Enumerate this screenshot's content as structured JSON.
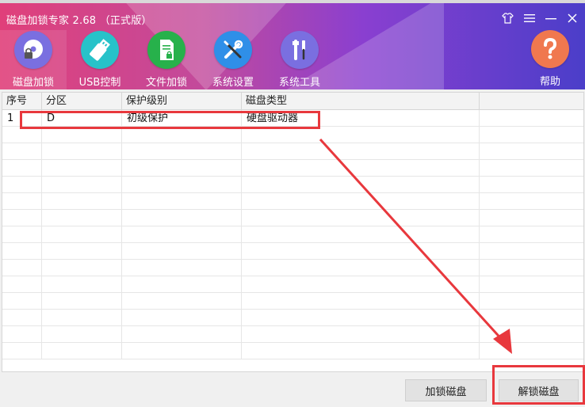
{
  "window": {
    "title": "磁盘加锁专家 2.68 （正式版）"
  },
  "nav": {
    "items": [
      {
        "label": "磁盘加锁",
        "icon": "disk-lock-icon",
        "color": "#7a6fe0"
      },
      {
        "label": "USB控制",
        "icon": "usb-icon",
        "color": "#27c2c9"
      },
      {
        "label": "文件加锁",
        "icon": "file-lock-icon",
        "color": "#27b14b"
      },
      {
        "label": "系统设置",
        "icon": "tools-icon",
        "color": "#2f8fe8"
      },
      {
        "label": "系统工具",
        "icon": "wrench-screwdriver-icon",
        "color": "#7a6fe0"
      }
    ],
    "help_label": "帮助",
    "help_color": "#f0784f"
  },
  "table": {
    "headers": [
      "序号",
      "分区",
      "保护级别",
      "磁盘类型"
    ],
    "rows": [
      [
        "1",
        "D",
        "初级保护",
        "硬盘驱动器"
      ]
    ]
  },
  "buttons": {
    "lock": "加锁磁盘",
    "unlock": "解锁磁盘"
  },
  "colors": {
    "highlight": "#e8383d",
    "header_start": "#e0407a",
    "header_end": "#4b3ec9"
  }
}
